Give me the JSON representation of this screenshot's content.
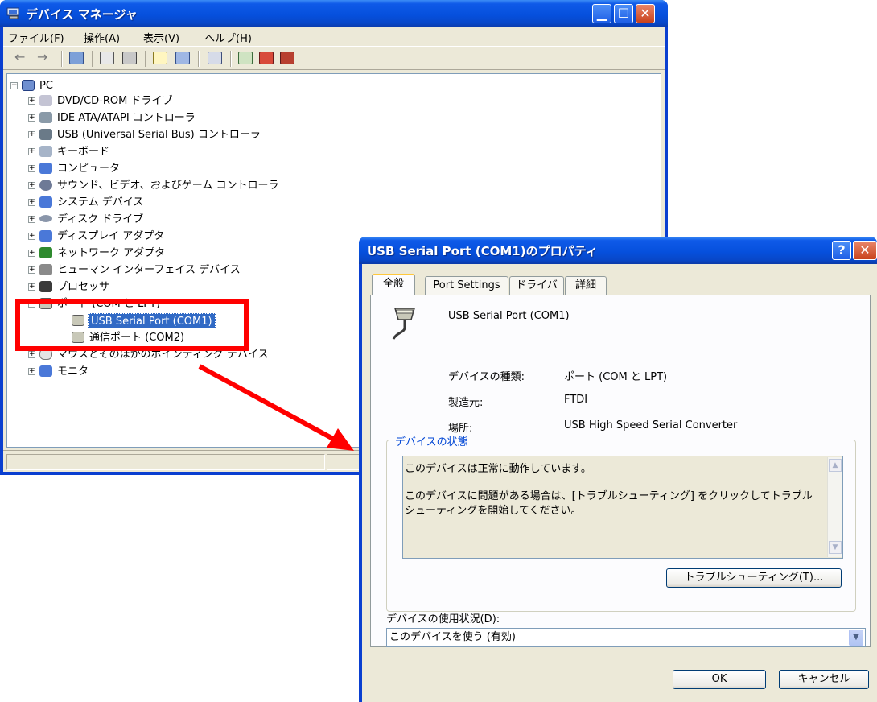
{
  "device_manager": {
    "title": "デバイス マネージャ",
    "menu": [
      "ファイル(F)",
      "操作(A)",
      "表示(V)",
      "ヘルプ(H)"
    ],
    "toolbar_icons": [
      "back-icon",
      "forward-icon",
      "view-icon",
      "properties-icon",
      "print-icon",
      "help-icon",
      "console-tree-icon",
      "scan-hardware-icon",
      "update-driver-icon",
      "uninstall-icon",
      "disable-icon"
    ],
    "tree": {
      "root": "PC",
      "categories": [
        {
          "label": "DVD/CD-ROM ドライブ",
          "icon": "dvd-drive-icon"
        },
        {
          "label": "IDE ATA/ATAPI コントローラ",
          "icon": "ide-controller-icon"
        },
        {
          "label": "USB (Universal Serial Bus) コントローラ",
          "icon": "usb-icon"
        },
        {
          "label": "キーボード",
          "icon": "keyboard-icon"
        },
        {
          "label": "コンピュータ",
          "icon": "computer-icon"
        },
        {
          "label": "サウンド、ビデオ、およびゲーム コントローラ",
          "icon": "sound-icon"
        },
        {
          "label": "システム デバイス",
          "icon": "system-device-icon"
        },
        {
          "label": "ディスク ドライブ",
          "icon": "disk-drive-icon"
        },
        {
          "label": "ディスプレイ アダプタ",
          "icon": "display-adapter-icon"
        },
        {
          "label": "ネットワーク アダプタ",
          "icon": "network-adapter-icon"
        },
        {
          "label": "ヒューマン インターフェイス デバイス",
          "icon": "hid-icon"
        },
        {
          "label": "プロセッサ",
          "icon": "processor-icon"
        },
        {
          "label": "ポート (COM と LPT)",
          "icon": "port-icon",
          "expanded": true,
          "children": [
            "USB Serial Port (COM1)",
            "通信ポート (COM2)"
          ]
        },
        {
          "label": "マウスとそのほかのポインティング デバイス",
          "icon": "mouse-icon"
        },
        {
          "label": "モニタ",
          "icon": "monitor-icon"
        }
      ],
      "selected": "USB Serial Port (COM1)"
    }
  },
  "properties": {
    "title": "USB Serial Port (COM1)のプロパティ",
    "tabs": [
      "全般",
      "Port Settings",
      "ドライバ",
      "詳細"
    ],
    "active_tab": "全般",
    "device_name": "USB Serial Port (COM1)",
    "info": [
      {
        "label": "デバイスの種類:",
        "value": "ポート (COM と LPT)"
      },
      {
        "label": "製造元:",
        "value": "FTDI"
      },
      {
        "label": "場所:",
        "value": "USB High Speed Serial Converter"
      }
    ],
    "status_group_title": "デバイスの状態",
    "status_line1": "このデバイスは正常に動作しています。",
    "status_line2": "このデバイスに問題がある場合は、[トラブルシューティング] をクリックしてトラブル",
    "status_line3": "シューティングを開始してください。",
    "troubleshoot_button": "トラブルシューティング(T)...",
    "usage_label": "デバイスの使用状況(D):",
    "usage_value": "このデバイスを使う (有効)",
    "ok_button": "OK",
    "cancel_button": "キャンセル"
  },
  "colors": {
    "annotation": "#ff0000",
    "selection": "#316ac5",
    "titlebar": "#0650dd"
  }
}
